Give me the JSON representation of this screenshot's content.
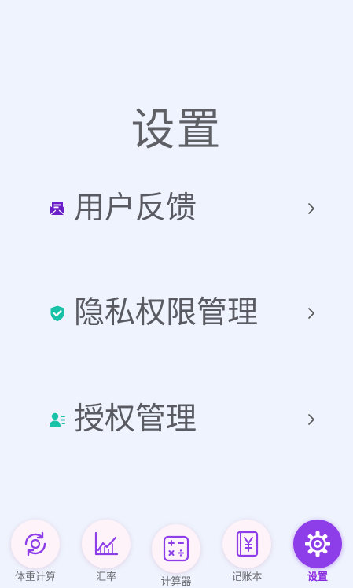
{
  "header": {
    "title": "设置"
  },
  "menu": {
    "items": [
      {
        "label": "用户反馈",
        "icon": "mail-icon"
      },
      {
        "label": "隐私权限管理",
        "icon": "shield-check-icon"
      },
      {
        "label": "授权管理",
        "icon": "user-list-icon"
      }
    ]
  },
  "tabbar": {
    "tabs": [
      {
        "label": "体重计算",
        "icon": "cycle-icon"
      },
      {
        "label": "汇率",
        "icon": "trend-chart-icon"
      },
      {
        "label": "计算器",
        "icon": "calculator-icon"
      },
      {
        "label": "记账本",
        "icon": "yen-book-icon"
      },
      {
        "label": "设置",
        "icon": "gear-icon",
        "active": true
      }
    ]
  },
  "colors": {
    "background": "#eef3fd",
    "accent": "#8e3ee8",
    "mail_icon": "#6a1fc7",
    "teal_icon": "#18c2a6",
    "tab_icon": "#8e3ee8"
  }
}
